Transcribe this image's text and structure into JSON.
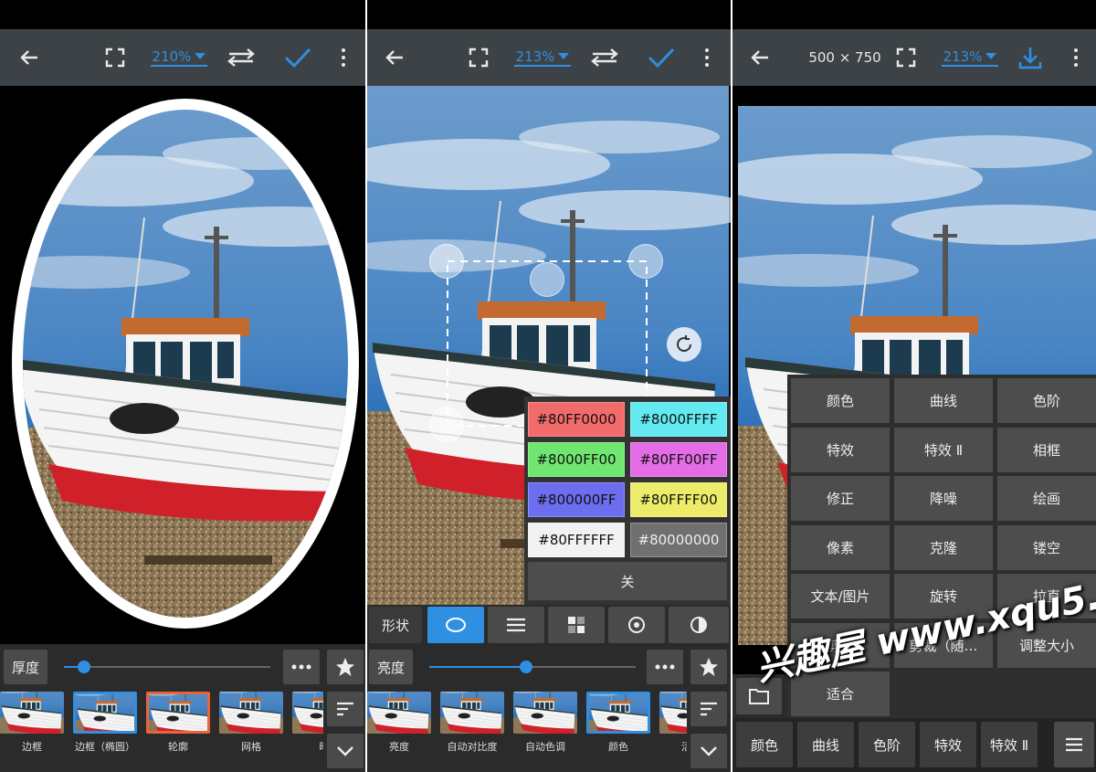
{
  "panel1": {
    "zoom": "210%",
    "bottom": {
      "param_label": "厚度",
      "slider_value": 0.15,
      "thumbnails": [
        "边框",
        "边框（椭圆）",
        "轮廓",
        "网格",
        "暗"
      ]
    }
  },
  "panel2": {
    "zoom": "213%",
    "colors": [
      {
        "label": "#80FF0000",
        "hex": "#f26b6b"
      },
      {
        "label": "#8000FFFF",
        "hex": "#62eaf0"
      },
      {
        "label": "#8000FF00",
        "hex": "#6fe66f"
      },
      {
        "label": "#80FF00FF",
        "hex": "#e46ce6"
      },
      {
        "label": "#800000FF",
        "hex": "#6d6df0"
      },
      {
        "label": "#80FFFF00",
        "hex": "#ecec6a"
      },
      {
        "label": "#80FFFFFF",
        "hex": "#f2f2f2"
      },
      {
        "label": "#80000000",
        "hex": "#707070"
      }
    ],
    "close_label": "关",
    "shape_label": "形状",
    "shape_icons": [
      "circle-shape-icon",
      "lines-shape-icon",
      "grid-shape-icon",
      "target-shape-icon",
      "half-circle-shape-icon"
    ],
    "bottom": {
      "param_label": "亮度",
      "slider_value": 0.6,
      "thumbnails": [
        "亮度",
        "自动对比度",
        "自动色调",
        "颜色",
        "活力"
      ]
    }
  },
  "panel3": {
    "dims": "500 × 750",
    "zoom": "213%",
    "menu": [
      "颜色",
      "曲线",
      "色阶",
      "特效",
      "特效 Ⅱ",
      "相框",
      "修正",
      "降噪",
      "绘画",
      "像素",
      "克隆",
      "镂空",
      "文本/图片",
      "旋转",
      "拉直",
      "剪裁",
      "剪裁（随…",
      "调整大小",
      "适合"
    ],
    "tabs": [
      "颜色",
      "曲线",
      "色阶",
      "特效",
      "特效 Ⅱ"
    ]
  },
  "watermark": "兴趣屋 www.xqu5.com",
  "colors": {
    "accent": "#2f8fe0",
    "toolbar": "#3d4246",
    "border_orange": "#e8643c"
  }
}
